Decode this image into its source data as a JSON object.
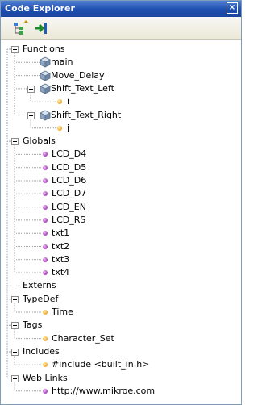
{
  "window": {
    "title": "Code Explorer",
    "close_glyph": "×"
  },
  "toolbar": {
    "buttons": [
      {
        "name": "tree-view-icon"
      },
      {
        "name": "jump-to-icon"
      }
    ]
  },
  "tree": {
    "functions": {
      "label": "Functions",
      "items": [
        {
          "label": "main"
        },
        {
          "label": "Move_Delay"
        },
        {
          "label": "Shift_Text_Left",
          "child": "i"
        },
        {
          "label": "Shift_Text_Right",
          "child": "j"
        }
      ]
    },
    "globals": {
      "label": "Globals",
      "items": [
        "LCD_D4",
        "LCD_D5",
        "LCD_D6",
        "LCD_D7",
        "LCD_EN",
        "LCD_RS",
        "txt1",
        "txt2",
        "txt3",
        "txt4"
      ]
    },
    "externs": {
      "label": "Externs"
    },
    "typedef": {
      "label": "TypeDef",
      "items": [
        "Time"
      ]
    },
    "tags": {
      "label": "Tags",
      "items": [
        "Character_Set"
      ]
    },
    "includes": {
      "label": "Includes",
      "items": [
        "#include <built_in.h>"
      ]
    },
    "weblinks": {
      "label": "Web Links",
      "items": [
        "http://www.mikroe.com"
      ]
    }
  },
  "colors": {
    "titlebar": "#1f4fb0",
    "border": "#7f9db9",
    "toolbar": "#ece9d8",
    "tree_line": "#a0a0a0"
  }
}
